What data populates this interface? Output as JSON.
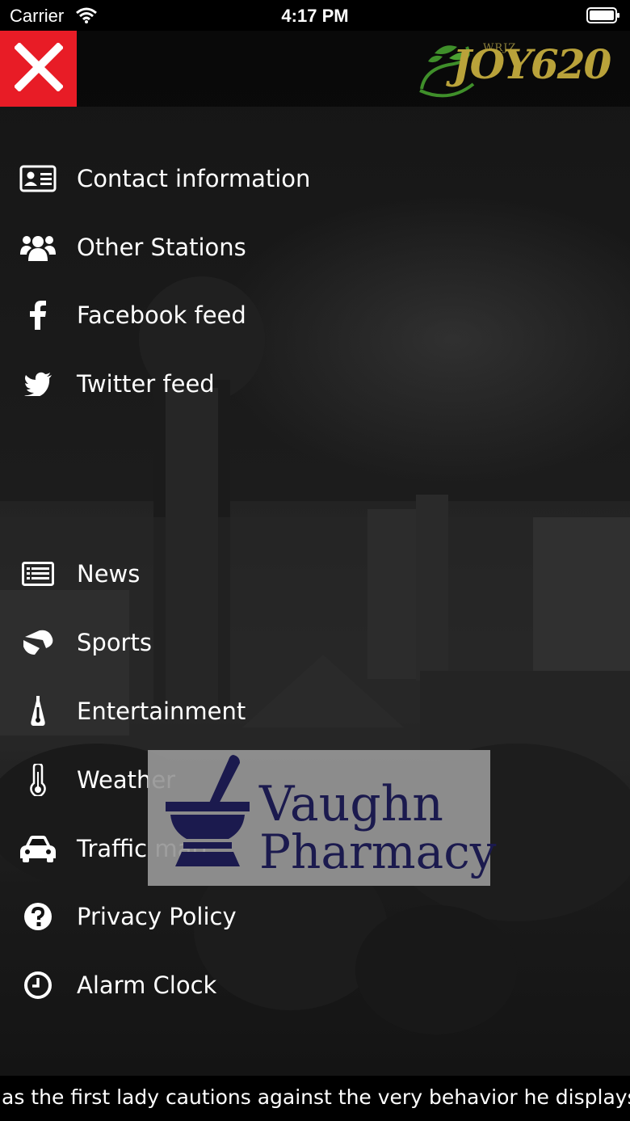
{
  "status_bar": {
    "carrier": "Carrier",
    "time": "4:17 PM"
  },
  "header": {
    "close_icon": "close-icon",
    "logo": {
      "small_text": "WRJZ",
      "main_text": "JOY620"
    }
  },
  "menu_top": [
    {
      "label": "Contact information",
      "icon": "contact-card-icon"
    },
    {
      "label": "Other Stations",
      "icon": "users-icon"
    },
    {
      "label": "Facebook feed",
      "icon": "facebook-icon"
    },
    {
      "label": "Twitter feed",
      "icon": "twitter-icon"
    }
  ],
  "menu_bottom": [
    {
      "label": "News",
      "icon": "newspaper-icon"
    },
    {
      "label": "Sports",
      "icon": "sports-icon"
    },
    {
      "label": "Entertainment",
      "icon": "microphone-icon"
    },
    {
      "label": "Weather",
      "icon": "thermometer-icon"
    },
    {
      "label": "Traffic map",
      "icon": "car-icon"
    },
    {
      "label": "Privacy Policy",
      "icon": "question-icon"
    },
    {
      "label": "Alarm Clock",
      "icon": "clock-icon"
    }
  ],
  "ad": {
    "line1": "Vaughn",
    "line2": "Pharmacy",
    "icon": "mortar-pestle-icon"
  },
  "ticker": {
    "text": "as the first lady cautions against the very behavior he displays"
  },
  "colors": {
    "close_bg": "#e81c26",
    "logo_gold": "#b9a23a",
    "logo_green": "#3f8f2a",
    "ad_text": "#1b1a4e"
  }
}
